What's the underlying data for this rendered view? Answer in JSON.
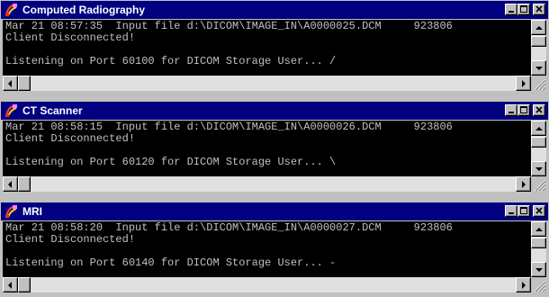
{
  "windows": [
    {
      "title": "Computed Radiography",
      "lines": [
        "Mar 21 08:57:35  Input file d:\\DICOM\\IMAGE_IN\\A0000025.DCM     923806",
        "Client Disconnected!",
        "",
        "Listening on Port 60100 for DICOM Storage User... /"
      ]
    },
    {
      "title": "CT Scanner",
      "lines": [
        "Mar 21 08:58:15  Input file d:\\DICOM\\IMAGE_IN\\A0000026.DCM     923806",
        "Client Disconnected!",
        "",
        "Listening on Port 60120 for DICOM Storage User... \\"
      ]
    },
    {
      "title": "MRI",
      "lines": [
        "Mar 21 08:58:20  Input file d:\\DICOM\\IMAGE_IN\\A0000027.DCM     923806",
        "Client Disconnected!",
        "",
        "Listening on Port 60140 for DICOM Storage User... -"
      ]
    }
  ],
  "colors": {
    "titlebar": "#000080",
    "console_bg": "#000000",
    "console_text": "#c0c0c0",
    "window_face": "#c0c0c0"
  },
  "icons": {
    "app": "dicom-app-icon",
    "minimize": "minimize-icon",
    "maximize": "maximize-icon",
    "close": "close-icon"
  }
}
